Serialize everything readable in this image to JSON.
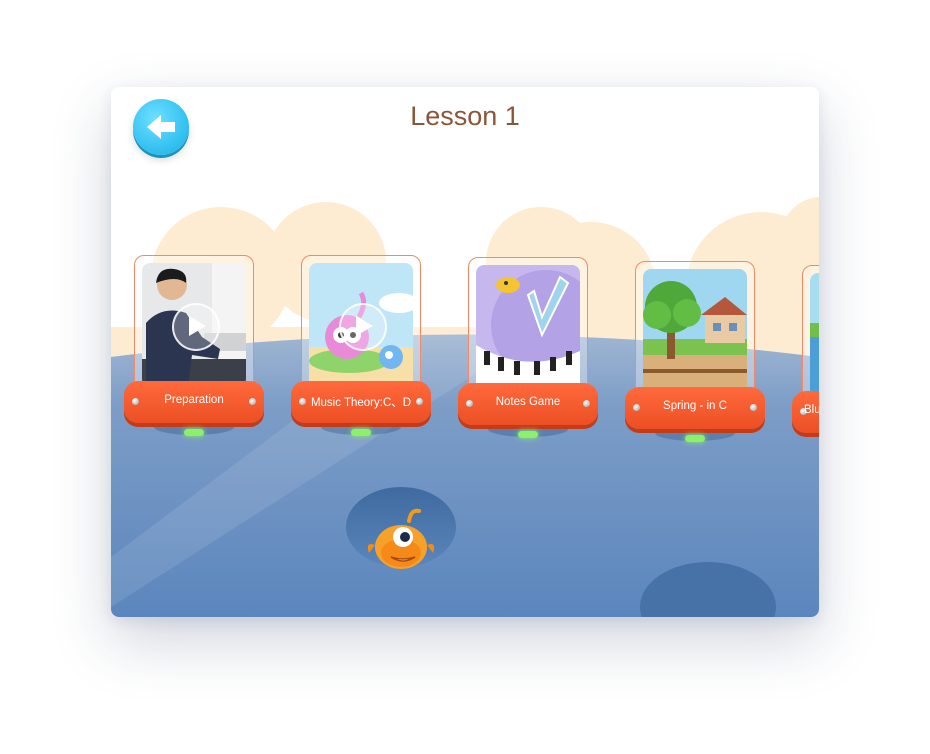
{
  "header": {
    "title": "Lesson 1",
    "back_icon": "arrow-left-icon"
  },
  "lessons": [
    {
      "label": "Preparation",
      "thumbnail": "piano-teacher-video",
      "has_video": true
    },
    {
      "label": "Music Theory:C、D",
      "thumbnail": "cartoon-notes-video",
      "has_video": true
    },
    {
      "label": "Notes Game",
      "thumbnail": "piano-keys-game",
      "has_video": false
    },
    {
      "label": "Spring - in C",
      "thumbnail": "tree-house-scene",
      "has_video": false
    },
    {
      "label": "Blu",
      "thumbnail": "blue-lake-scene",
      "has_video": false
    }
  ],
  "colors": {
    "title": "#8a5637",
    "plate": "#ef5a2c",
    "back_button": "#36c3f2",
    "water": "#6d93c2",
    "hills": "#fde8cc"
  },
  "mascot": {
    "icon": "orange-music-note-mascot-icon"
  }
}
